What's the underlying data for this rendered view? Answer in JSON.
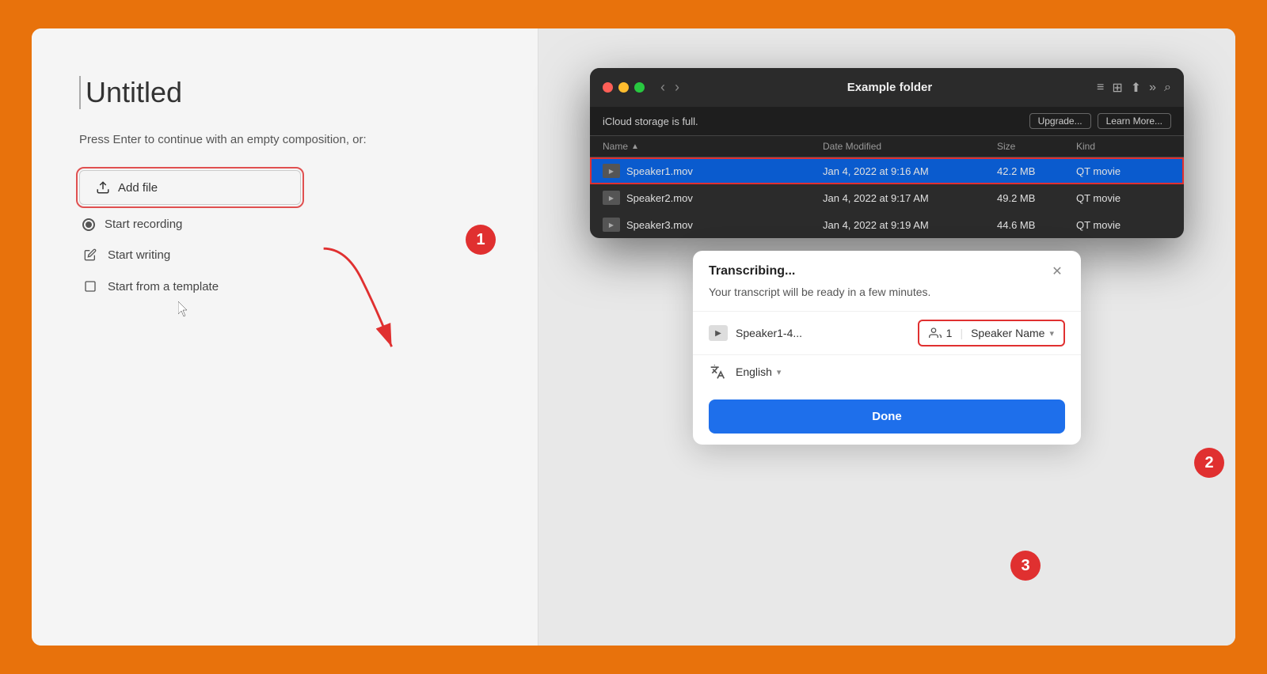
{
  "outer": {
    "left_panel": {
      "title": "Untitled",
      "subtitle": "Press Enter to continue with an empty composition, or:",
      "add_file_btn": "Add file",
      "menu_items": [
        {
          "id": "record",
          "label": "Start recording",
          "type": "radio"
        },
        {
          "id": "write",
          "label": "Start writing",
          "type": "pencil"
        },
        {
          "id": "template",
          "label": "Start from a template",
          "type": "square"
        }
      ]
    },
    "finder": {
      "title": "Example folder",
      "icloud_message": "iCloud storage is full.",
      "upgrade_btn": "Upgrade...",
      "learn_btn": "Learn More...",
      "columns": {
        "name": "Name",
        "date_modified": "Date Modified",
        "size": "Size",
        "kind": "Kind"
      },
      "files": [
        {
          "name": "Speaker1.mov",
          "date": "Jan 4, 2022 at 9:16 AM",
          "size": "42.2 MB",
          "kind": "QT movie",
          "selected": true
        },
        {
          "name": "Speaker2.mov",
          "date": "Jan 4, 2022 at 9:17 AM",
          "size": "49.2 MB",
          "kind": "QT movie",
          "selected": false
        },
        {
          "name": "Speaker3.mov",
          "date": "Jan 4, 2022 at 9:19 AM",
          "size": "44.6 MB",
          "kind": "QT movie",
          "selected": false
        }
      ]
    },
    "transcribing_modal": {
      "title": "Transcribing...",
      "subtitle": "Your transcript will be ready in a few minutes.",
      "file_label": "Speaker1-4...",
      "speaker_count": "1",
      "speaker_name": "Speaker Name",
      "language": "English",
      "done_btn": "Done"
    },
    "badges": [
      "1",
      "2",
      "3"
    ]
  }
}
